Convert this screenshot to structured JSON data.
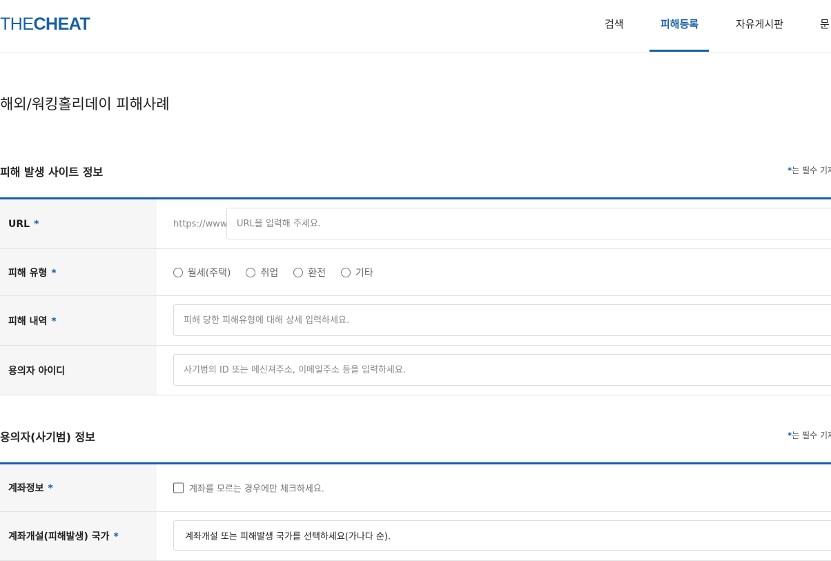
{
  "logo": {
    "thin": "THE",
    "bold": "CHEAT"
  },
  "nav": {
    "items": [
      {
        "label": "검색"
      },
      {
        "label": "피해등록"
      },
      {
        "label": "자유게시판"
      },
      {
        "label": "문"
      }
    ],
    "active_index": 1
  },
  "page_title": "해외/워킹홀리데이 피해사례",
  "sections": [
    {
      "title": "피해 발생 사이트 정보",
      "required_note_star": "*",
      "required_note": "는 필수 기재"
    },
    {
      "title": "용의자(사기범) 정보",
      "required_note_star": "*",
      "required_note": "는 필수 기재"
    }
  ],
  "site_form": {
    "url": {
      "label": "URL",
      "star": "*",
      "prefix": "https://www.",
      "placeholder": "URL을 입력해 주세요.",
      "value": ""
    },
    "damage_type": {
      "label": "피해 유형",
      "star": "*",
      "options": [
        "월세(주택)",
        "취업",
        "환전",
        "기타"
      ],
      "selected": null
    },
    "damage_detail": {
      "label": "피해 내역",
      "star": "*",
      "placeholder": "피해 당한 피해유형에 대해 상세 입력하세요.",
      "value": ""
    },
    "suspect_id": {
      "label": "용의자 아이디",
      "placeholder": "사기범의 ID 또는 메신져주소, 이메일주소 등을 입력하세요.",
      "value": ""
    }
  },
  "suspect_form": {
    "account_info": {
      "label": "계좌정보",
      "star": "*",
      "checkbox_label": "계좌를 모르는 경우에만 체크하세요.",
      "checked": false
    },
    "account_country": {
      "label": "계좌개설(피해발생) 국가",
      "star": "*",
      "selected_text": "계좌개설 또는 피해발생 국가를 선택하세요(가나다 순)."
    }
  },
  "colors": {
    "accent": "#1560a8",
    "label_bg": "#f6f6f6",
    "border": "#e3e3e3"
  }
}
